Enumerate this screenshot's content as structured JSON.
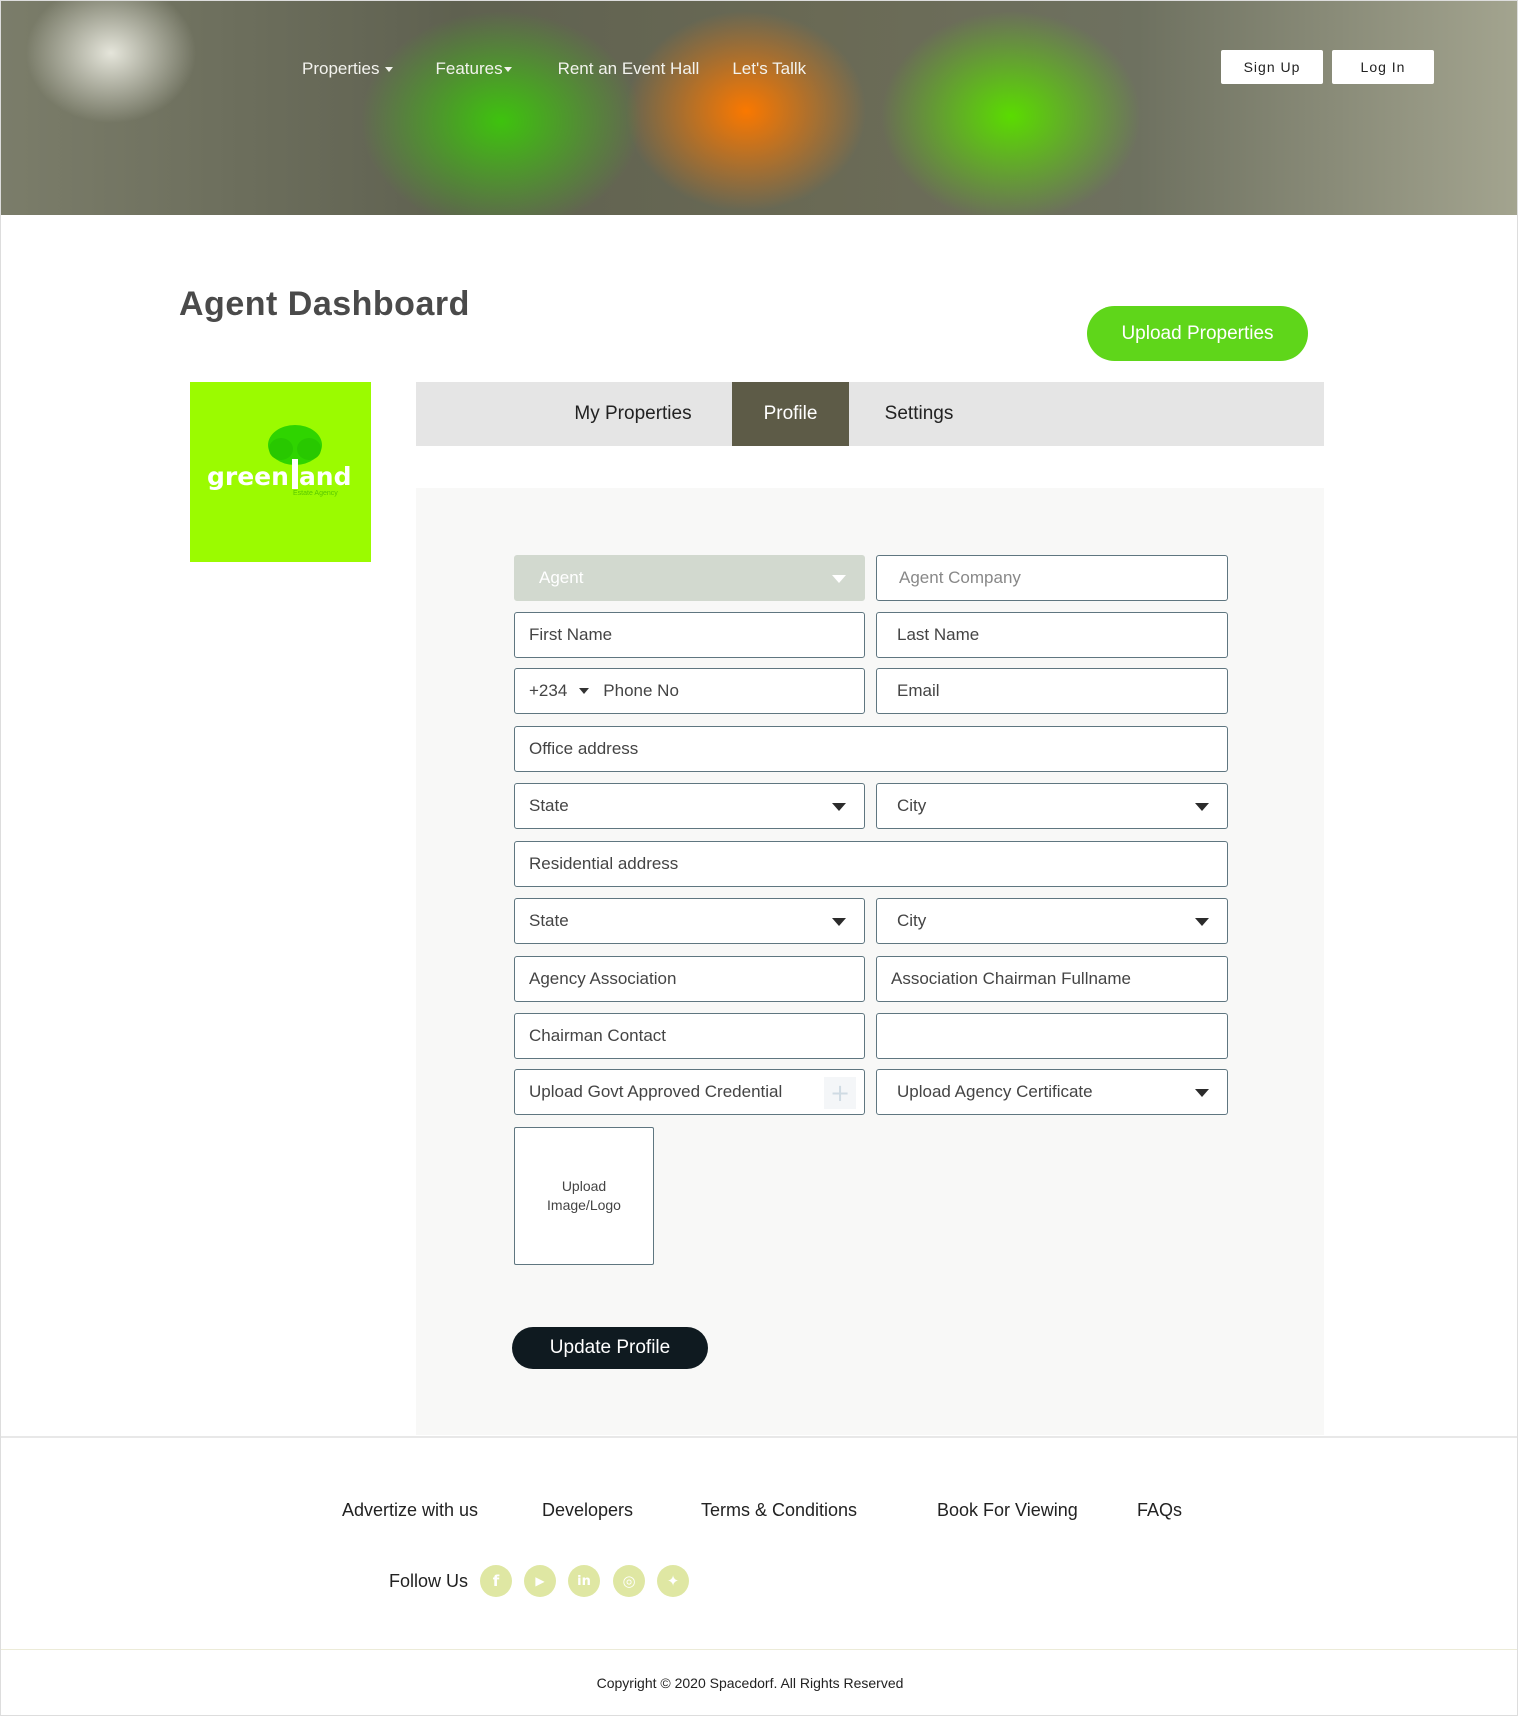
{
  "nav": {
    "items": [
      {
        "label": "Properties",
        "has_caret": true
      },
      {
        "label": "Features",
        "has_caret": true
      },
      {
        "label": "Rent an Event Hall",
        "has_caret": false
      },
      {
        "label": "Let's Tallk",
        "has_caret": false
      }
    ],
    "sign_up": "Sign Up",
    "log_in": "Log In"
  },
  "page": {
    "title": "Agent Dashboard",
    "upload_button": "Upload Properties"
  },
  "logo": {
    "word": "green",
    "word2": "and",
    "tagline": "Estate Agency",
    "brand_color": "#9bfb00"
  },
  "tabs": [
    {
      "label": "My Properties",
      "active": false
    },
    {
      "label": "Profile",
      "active": true
    },
    {
      "label": "Settings",
      "active": false
    }
  ],
  "form": {
    "role_select": "Agent",
    "agent_company": "Agent Company",
    "first_name": "First Name",
    "last_name": "Last Name",
    "phone_code": "+234",
    "phone": "Phone No",
    "email": "Email",
    "office_address": "Office address",
    "office_state": "State",
    "office_city": "City",
    "residential_address": "Residential address",
    "res_state": "State",
    "res_city": "City",
    "agency_association": "Agency Association",
    "chairman_fullname": "Association Chairman Fullname",
    "chairman_contact": "Chairman Contact",
    "extra_field": "",
    "upload_credential": "Upload Govt Approved Credential",
    "upload_certificate": "Upload Agency Certificate",
    "upload_image": "Upload Image/Logo",
    "update_button": "Update Profile"
  },
  "footer": {
    "links": [
      "Advertize with us",
      "Developers",
      "Terms & Conditions",
      "Book For Viewing",
      "FAQs"
    ],
    "follow_label": "Follow Us",
    "social": [
      {
        "icon": "facebook-icon",
        "glyph": "f"
      },
      {
        "icon": "youtube-icon",
        "glyph": "▶"
      },
      {
        "icon": "linkedin-icon",
        "glyph": "in"
      },
      {
        "icon": "instagram-icon",
        "glyph": "◎"
      },
      {
        "icon": "twitter-icon",
        "glyph": "✦"
      }
    ],
    "copyright": "Copyright © 2020 Spacedorf. All Rights Reserved"
  },
  "colors": {
    "accent_green": "#5fd61a",
    "active_tab": "#5d5b47",
    "dark_button": "#0f1a20",
    "social_icon_bg": "#dfe7a3"
  }
}
